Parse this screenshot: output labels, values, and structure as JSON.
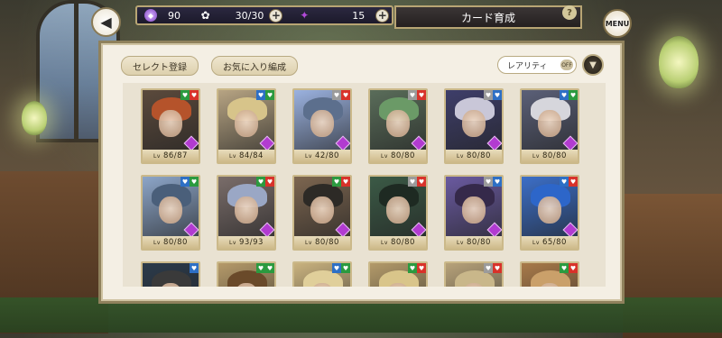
{
  "topbar": {
    "back_icon": "back-arrow-icon",
    "gems": "90",
    "stamina": "30/30",
    "dragon": "15",
    "plus_label": "+",
    "screen_title": "カード育成",
    "help_label": "?",
    "menu_label": "MENU"
  },
  "panel": {
    "select_register": "セレクト登録",
    "favorite_edit": "お気に入り編成",
    "sort_label": "レアリティ",
    "sort_toggle": "OFF",
    "sort_order_icon": "▼"
  },
  "cards": [
    {
      "level": "86/87",
      "badges": [
        "green",
        "red"
      ],
      "hair": "#b5532b",
      "bg": "#5b4a3c"
    },
    {
      "level": "84/84",
      "badges": [
        "blue",
        "green"
      ],
      "hair": "#d7c48a",
      "bg": "#b7a483"
    },
    {
      "level": "42/80",
      "badges": [
        "gray",
        "red"
      ],
      "hair": "#5c6f8d",
      "bg": "#9bb2e0"
    },
    {
      "level": "80/80",
      "badges": [
        "gray",
        "red"
      ],
      "hair": "#6b9a67",
      "bg": "#5a6d5a"
    },
    {
      "level": "80/80",
      "badges": [
        "gray",
        "blue"
      ],
      "hair": "#c9c7d8",
      "bg": "#3e3e6a"
    },
    {
      "level": "80/80",
      "badges": [
        "blue",
        "green"
      ],
      "hair": "#d6d6dc",
      "bg": "#5b6078"
    },
    {
      "level": "80/80",
      "badges": [
        "blue",
        "green"
      ],
      "hair": "#4a5f7a",
      "bg": "#8da6c9"
    },
    {
      "level": "93/93",
      "badges": [
        "green",
        "red"
      ],
      "hair": "#9aa7c5",
      "bg": "#7a6d6a"
    },
    {
      "level": "80/80",
      "badges": [
        "green",
        "red"
      ],
      "hair": "#2d2a26",
      "bg": "#7d6650"
    },
    {
      "level": "80/80",
      "badges": [
        "gray",
        "red"
      ],
      "hair": "#1e2a22",
      "bg": "#3b5a46"
    },
    {
      "level": "80/80",
      "badges": [
        "gray",
        "blue"
      ],
      "hair": "#35294a",
      "bg": "#6a5aa0"
    },
    {
      "level": "65/80",
      "badges": [
        "blue",
        "red"
      ],
      "hair": "#2d66c9",
      "bg": "#3c6fc8"
    },
    {
      "level": "",
      "badges": [
        "blue"
      ],
      "hair": "#3a3a3a",
      "bg": "#2b3a4a"
    },
    {
      "level": "",
      "badges": [
        "green",
        "green"
      ],
      "hair": "#6a4a2a",
      "bg": "#b59a6a"
    },
    {
      "level": "",
      "badges": [
        "blue",
        "green"
      ],
      "hair": "#e0cf9a",
      "bg": "#c9b27f"
    },
    {
      "level": "",
      "badges": [
        "green",
        "red"
      ],
      "hair": "#d9c58a",
      "bg": "#b39a6a"
    },
    {
      "level": "",
      "badges": [
        "gray",
        "red"
      ],
      "hair": "#c9b78a",
      "bg": "#b7a27a"
    },
    {
      "level": "",
      "badges": [
        "green",
        "red"
      ],
      "hair": "#caa06a",
      "bg": "#a87a4a"
    }
  ],
  "level_prefix": "Lv",
  "badge_glyph": "♥"
}
